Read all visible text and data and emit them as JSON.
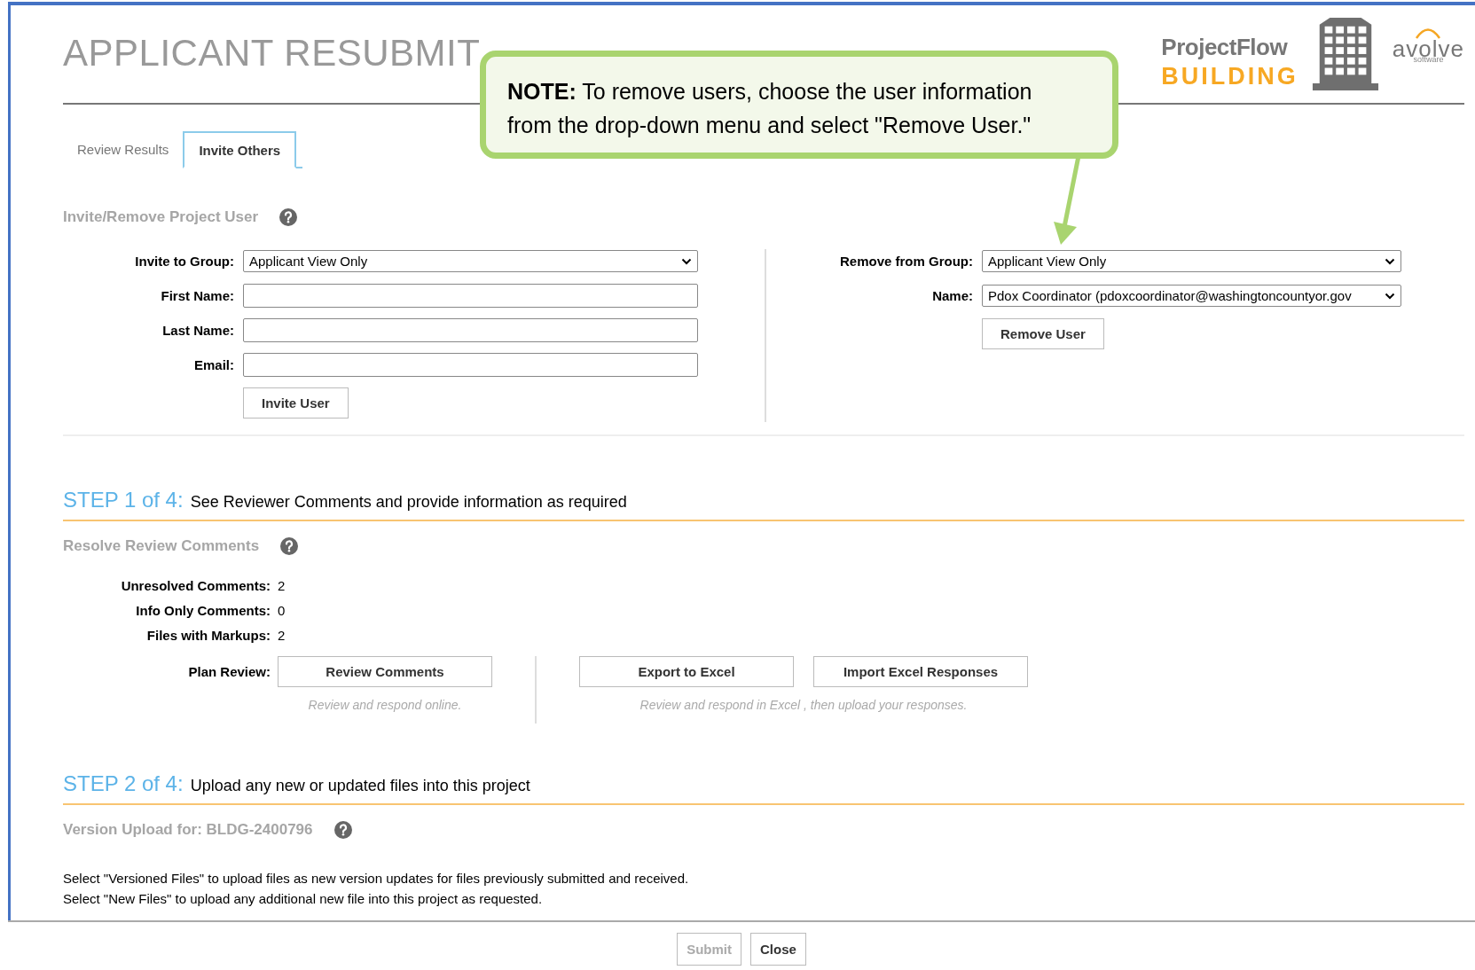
{
  "header": {
    "title": "APPLICANT RESUBMIT",
    "logo": {
      "product": "ProjectFlow",
      "module": "BUILDING",
      "vendor": "avolve",
      "vendor_tagline": "software"
    }
  },
  "note": {
    "text": "**NOTE:** To remove users, choose the user  information from the drop-down menu and select \"Remove User.\""
  },
  "tabs": [
    {
      "label": "Review Results",
      "selected": false
    },
    {
      "label": "Invite Others",
      "selected": true
    }
  ],
  "invite_section": {
    "heading": "Invite/Remove Project User",
    "invite_form": {
      "fields": [
        {
          "kind": "select",
          "label": "Invite to Group:",
          "value": "Applicant View Only"
        },
        {
          "kind": "text",
          "label": "First Name:"
        },
        {
          "kind": "text",
          "label": "Last Name:"
        },
        {
          "kind": "text",
          "label": "Email:"
        }
      ],
      "button": "Invite User"
    },
    "remove_form": {
      "fields": [
        {
          "kind": "select",
          "label": "Remove from Group:",
          "value": "Applicant View Only"
        },
        {
          "kind": "select",
          "label": "Name:",
          "value": "Pdox Coordinator (pdoxcoordinator@washingtoncountyor.gov"
        }
      ],
      "button": "Remove User"
    }
  },
  "step1": {
    "step": "STEP 1 of 4:",
    "description": "See Reviewer Comments and provide information as required",
    "heading": "Resolve Review Comments",
    "stats": [
      {
        "label": "Unresolved Comments:",
        "value": "2"
      },
      {
        "label": "Info Only Comments:",
        "value": "0"
      },
      {
        "label": "Files with Markups:",
        "value": "2"
      }
    ],
    "plan_review": {
      "label": "Plan Review:",
      "groups": [
        {
          "buttons": [
            "Review Comments"
          ],
          "hint": "Review and respond online."
        },
        {
          "buttons": [
            "Export to Excel",
            "Import Excel Responses"
          ],
          "hint": "Review and respond in Excel , then upload your responses."
        }
      ]
    }
  },
  "step2": {
    "step": "STEP 2 of 4:",
    "description": "Upload any new or updated files into this project",
    "heading": "Version Upload for: BLDG-2400796",
    "instructions": [
      "Select \"Versioned Files\" to upload files as new version updates for files previously submitted and received.",
      "Select \"New Files\" to upload any additional new file into this project as requested."
    ]
  },
  "footer": {
    "buttons": [
      {
        "label": "Submit",
        "disabled": true
      },
      {
        "label": "Close",
        "disabled": false
      }
    ]
  }
}
